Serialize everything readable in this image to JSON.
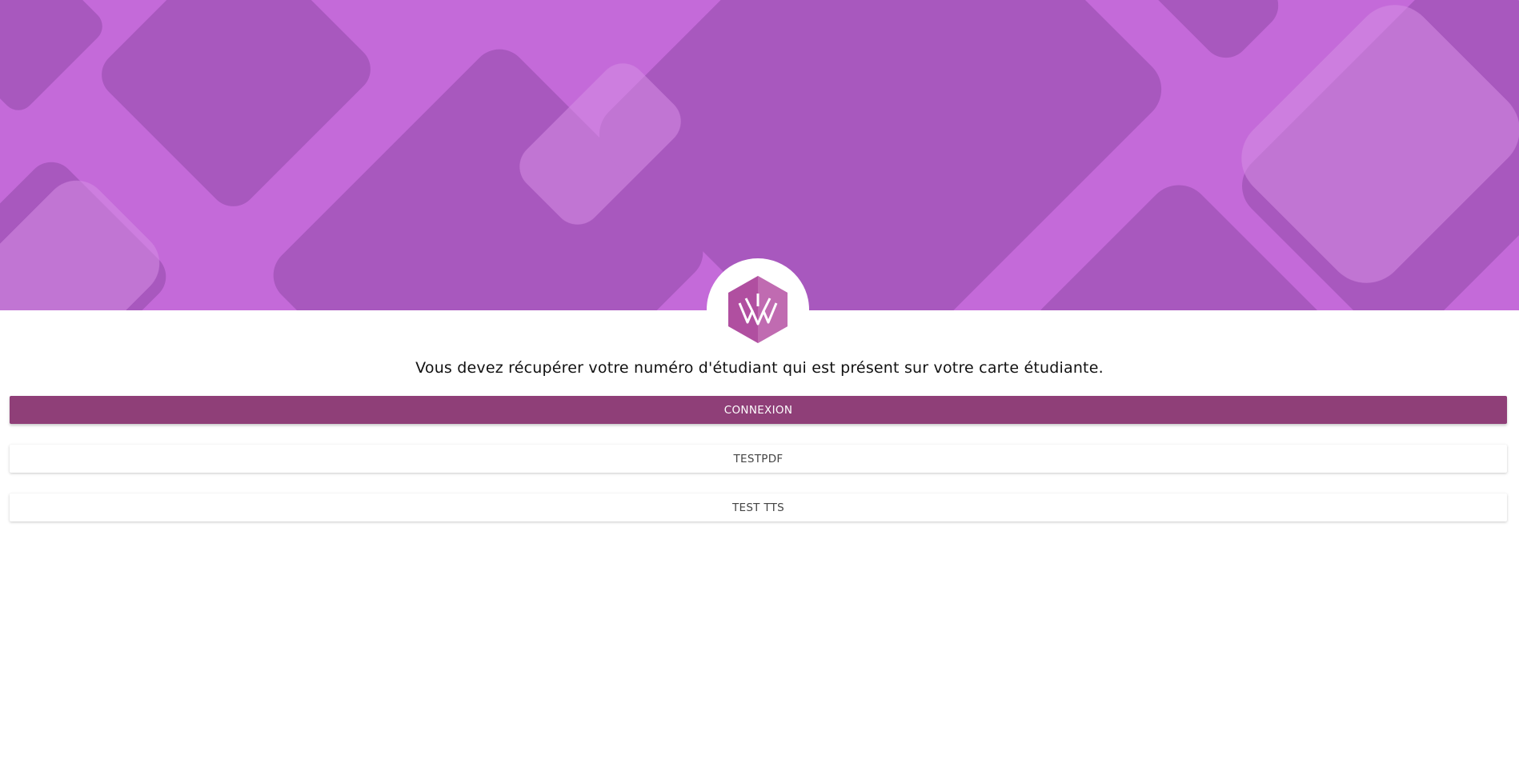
{
  "header": {
    "background_color": "#c46ad9",
    "device_shade_color": "#a455ba",
    "logo": "hexagon-crown-logo",
    "logo_color": "#b04fa0"
  },
  "main": {
    "notice": "Vous devez récupérer votre numéro d'étudiant qui est présent sur votre carte étudiante.",
    "buttons": {
      "connexion": "CONNEXION",
      "testpdf": "TESTPDF",
      "test_tts": "TEST TTS"
    },
    "primary_color": "#8f3f78"
  }
}
